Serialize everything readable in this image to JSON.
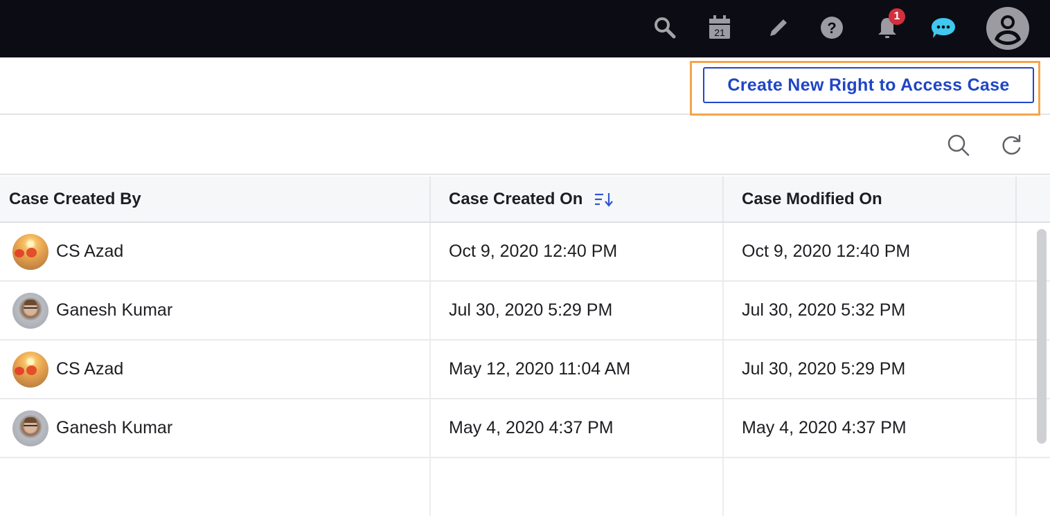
{
  "topbar": {
    "icons": [
      "search-icon",
      "calendar-icon",
      "pencil-icon",
      "help-icon",
      "bell-icon",
      "chat-icon",
      "user-avatar-icon"
    ],
    "calendar_day": "21",
    "notification_count": "1",
    "colors": {
      "background": "#0b0c14",
      "icon": "#9b9ba1",
      "chat": "#3fc8f0",
      "badge": "#d32f3f"
    }
  },
  "actions": {
    "create_button_label": "Create New Right to Access Case",
    "colors": {
      "button_text": "#1f45c5",
      "highlight": "#f5a44a"
    }
  },
  "toolbar": {
    "icons": [
      "search-icon",
      "refresh-icon"
    ]
  },
  "table": {
    "columns": [
      {
        "label": "Case Created By"
      },
      {
        "label": "Case Created On",
        "sort_icon": "sort-descending-icon",
        "sorted": true
      },
      {
        "label": "Case Modified On"
      }
    ],
    "rows": [
      {
        "created_by": "CS Azad",
        "avatar": "sunset-avatar",
        "created_on": "Oct 9, 2020 12:40 PM",
        "modified_on": "Oct 9, 2020 12:40 PM"
      },
      {
        "created_by": "Ganesh Kumar",
        "avatar": "man-avatar",
        "created_on": "Jul 30, 2020 5:29 PM",
        "modified_on": "Jul 30, 2020 5:32 PM"
      },
      {
        "created_by": "CS Azad",
        "avatar": "sunset-avatar",
        "created_on": "May 12, 2020 11:04 AM",
        "modified_on": "Jul 30, 2020 5:29 PM"
      },
      {
        "created_by": "Ganesh Kumar",
        "avatar": "man-avatar",
        "created_on": "May 4, 2020 4:37 PM",
        "modified_on": "May 4, 2020 4:37 PM"
      }
    ]
  }
}
